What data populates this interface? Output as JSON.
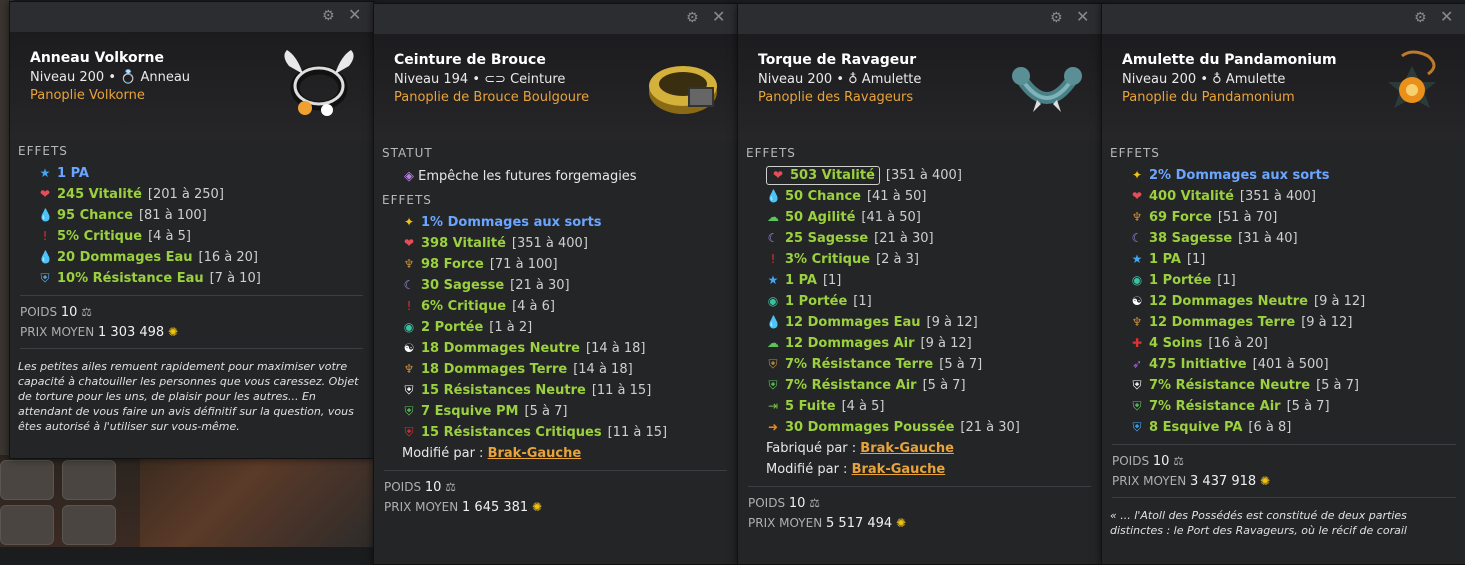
{
  "cards": [
    {
      "name": "Anneau Volkorne",
      "level": "Niveau 200",
      "type_icon": "ring-icon",
      "type": "Anneau",
      "panoplie": "Panoplie Volkorne",
      "effects_title": "EFFETS",
      "effects": [
        {
          "icon": "star-blue-icon",
          "value": "1 PA",
          "range": "",
          "color": "blue"
        },
        {
          "icon": "heart-icon",
          "value": "245",
          "label": " Vitalité",
          "range": "[201 à 250]"
        },
        {
          "icon": "water-drop-icon",
          "value": "95",
          "label": " Chance",
          "range": "[81 à 100]"
        },
        {
          "icon": "exclamation-icon",
          "value": "5%",
          "label": " Critique",
          "range": "[4 à 5]"
        },
        {
          "icon": "water-drop-icon",
          "value": "20",
          "label": " Dommages Eau",
          "range": "[16 à 20]"
        },
        {
          "icon": "water-shield-icon",
          "value": "10%",
          "label": " Résistance Eau",
          "range": "[7 à 10]"
        }
      ],
      "poids_label": "POIDS",
      "poids": "10",
      "prix_label": "PRIX MOYEN",
      "prix": "1 303 498",
      "description": "Les petites ailes remuent rapidement pour maximiser votre capacité à chatouiller les personnes que vous caressez. Objet de torture pour les uns, de plaisir pour les autres... En attendant de vous faire un avis définitif sur la question, vous êtes autorisé à l'utiliser sur vous-même."
    },
    {
      "name": "Ceinture de Brouce",
      "level": "Niveau 194",
      "type": "Ceinture",
      "panoplie": "Panoplie de Brouce Boulgoure",
      "status_title": "STATUT",
      "status": "Empêche les futures forgemagies",
      "effects_title": "EFFETS",
      "effects": [
        {
          "icon": "star-yellow-icon",
          "value": "1% Dommages aux sorts",
          "range": "",
          "color": "blue"
        },
        {
          "icon": "heart-icon",
          "value": "398",
          "label": " Vitalité",
          "range": "[351 à 400]"
        },
        {
          "icon": "earth-icon",
          "value": "98",
          "label": " Force",
          "range": "[71 à 100]"
        },
        {
          "icon": "moon-icon",
          "value": "30",
          "label": " Sagesse",
          "range": "[21 à 30]"
        },
        {
          "icon": "exclamation-icon",
          "value": "6%",
          "label": " Critique",
          "range": "[4 à 6]"
        },
        {
          "icon": "eye-icon",
          "value": "2",
          "label": " Portée",
          "range": "[1 à 2]"
        },
        {
          "icon": "yin-yang-icon",
          "value": "18",
          "label": " Dommages Neutre",
          "range": "[14 à 18]"
        },
        {
          "icon": "earth-icon",
          "value": "18",
          "label": " Dommages Terre",
          "range": "[14 à 18]"
        },
        {
          "icon": "neutral-shield-icon",
          "value": "15",
          "label": " Résistances Neutre",
          "range": "[11 à 15]"
        },
        {
          "icon": "green-shield-icon",
          "value": "7",
          "label": " Esquive PM",
          "range": "[5 à 7]"
        },
        {
          "icon": "red-shield-icon",
          "value": "15",
          "label": " Résistances Critiques",
          "range": "[11 à 15]"
        }
      ],
      "modified_label": "Modifié par :",
      "modified_by": "Brak-Gauche",
      "poids_label": "POIDS",
      "poids": "10",
      "prix_label": "PRIX MOYEN",
      "prix": "1 645 381"
    },
    {
      "name": "Torque de Ravageur",
      "level": "Niveau 200",
      "type": "Amulette",
      "panoplie": "Panoplie des Ravageurs",
      "effects_title": "EFFETS",
      "effects": [
        {
          "icon": "heart-icon",
          "value": "503",
          "label": " Vitalité",
          "range": "[351 à 400]",
          "boxed": true
        },
        {
          "icon": "water-drop-icon",
          "value": "50",
          "label": " Chance",
          "range": "[41 à 50]"
        },
        {
          "icon": "cloud-icon",
          "value": "50",
          "label": " Agilité",
          "range": "[41 à 50]"
        },
        {
          "icon": "moon-icon",
          "value": "25",
          "label": " Sagesse",
          "range": "[21 à 30]"
        },
        {
          "icon": "exclamation-icon",
          "value": "3%",
          "label": " Critique",
          "range": "[2 à 3]"
        },
        {
          "icon": "star-blue-icon",
          "value": "1",
          "label": " PA",
          "range": "[1]"
        },
        {
          "icon": "eye-icon",
          "value": "1",
          "label": " Portée",
          "range": "[1]"
        },
        {
          "icon": "water-drop-icon",
          "value": "12",
          "label": " Dommages Eau",
          "range": "[9 à 12]"
        },
        {
          "icon": "cloud-icon",
          "value": "12",
          "label": " Dommages Air",
          "range": "[9 à 12]"
        },
        {
          "icon": "earth-shield-icon",
          "value": "7%",
          "label": " Résistance Terre",
          "range": "[5 à 7]"
        },
        {
          "icon": "green-shield-icon",
          "value": "7%",
          "label": " Résistance Air",
          "range": "[5 à 7]"
        },
        {
          "icon": "flee-icon",
          "value": "5",
          "label": " Fuite",
          "range": "[4 à 5]"
        },
        {
          "icon": "arrow-icon",
          "value": "30",
          "label": " Dommages Poussée",
          "range": "[21 à 30]"
        }
      ],
      "crafted_label": "Fabriqué par :",
      "crafted_by": "Brak-Gauche",
      "modified_label": "Modifié par :",
      "modified_by": "Brak-Gauche",
      "poids_label": "POIDS",
      "poids": "10",
      "prix_label": "PRIX MOYEN",
      "prix": "5 517 494"
    },
    {
      "name": "Amulette du Pandamonium",
      "level": "Niveau 200",
      "type": "Amulette",
      "panoplie": "Panoplie du Pandamonium",
      "effects_title": "EFFETS",
      "effects": [
        {
          "icon": "star-yellow-icon",
          "value": "2% Dommages aux sorts",
          "range": "",
          "color": "blue"
        },
        {
          "icon": "heart-icon",
          "value": "400",
          "label": " Vitalité",
          "range": "[351 à 400]"
        },
        {
          "icon": "earth-icon",
          "value": "69",
          "label": " Force",
          "range": "[51 à 70]"
        },
        {
          "icon": "moon-icon",
          "value": "38",
          "label": " Sagesse",
          "range": "[31 à 40]"
        },
        {
          "icon": "star-blue-icon",
          "value": "1",
          "label": " PA",
          "range": "[1]"
        },
        {
          "icon": "eye-icon",
          "value": "1",
          "label": " Portée",
          "range": "[1]"
        },
        {
          "icon": "yin-yang-icon",
          "value": "12",
          "label": " Dommages Neutre",
          "range": "[9 à 12]"
        },
        {
          "icon": "earth-icon",
          "value": "12",
          "label": " Dommages Terre",
          "range": "[9 à 12]"
        },
        {
          "icon": "heal-cross-icon",
          "value": "4",
          "label": " Soins",
          "range": "[16 à 20]"
        },
        {
          "icon": "initiative-icon",
          "value": "475",
          "label": " Initiative",
          "range": "[401 à 500]"
        },
        {
          "icon": "neutral-shield-icon",
          "value": "7%",
          "label": " Résistance Neutre",
          "range": "[5 à 7]"
        },
        {
          "icon": "green-shield-icon",
          "value": "7%",
          "label": " Résistance Air",
          "range": "[5 à 7]"
        },
        {
          "icon": "blue-shield-icon",
          "value": "8",
          "label": " Esquive PA",
          "range": "[6 à 8]"
        }
      ],
      "poids_label": "POIDS",
      "poids": "10",
      "prix_label": "PRIX MOYEN",
      "prix": "3 437 918",
      "description": "« ... l'Atoll des Possédés est constitué de deux parties distinctes : le Port des Ravageurs, où le récif de corail"
    }
  ]
}
